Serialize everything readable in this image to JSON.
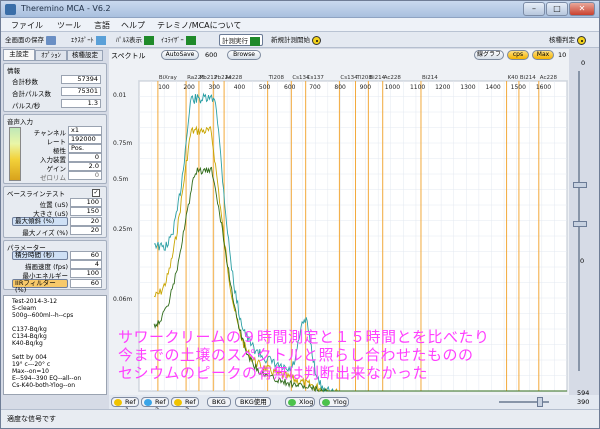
{
  "window": {
    "title": "Theremino MCA - V6.2"
  },
  "menu": [
    "ファイル",
    "ツール",
    "言語",
    "ヘルプ",
    "テレミノ/MCAについて"
  ],
  "toolbar": {
    "save_all": "全画面の保存",
    "export": "ｴｸｽﾎﾟｰﾄ",
    "pulse_display": "ﾊﾟﾙｽ表示",
    "equalizer": "ｲｺﾗｲｻﾞｰ",
    "measure": "計測実行",
    "new_measure": "新規計測開始",
    "nuclide": "核種判定"
  },
  "left": {
    "tabs": [
      "主設定",
      "ｵﾌﾟｼｮﾝ",
      "核種設定"
    ],
    "info": {
      "title": "情報",
      "rows": [
        {
          "label": "合計秒数",
          "value": "57394"
        },
        {
          "label": "合計パルス数",
          "value": "75301"
        },
        {
          "label": "パルス/秒",
          "value": "1.3"
        }
      ]
    },
    "audio": {
      "title": "音声入力",
      "rows": [
        {
          "label": "チャンネル",
          "value": "x1"
        },
        {
          "label": "レート",
          "value": "192000"
        },
        {
          "label": "極性",
          "value": "Pos."
        },
        {
          "label": "入力装置",
          "value": "0"
        },
        {
          "label": "ゲイン",
          "value": "2.0"
        },
        {
          "label": "ゼロリム",
          "value": "0"
        }
      ]
    },
    "baseline": {
      "title": "ベースラインテスト",
      "rows": [
        {
          "label": "位置 (uS)",
          "value": "100"
        },
        {
          "label": "大きさ (uS)",
          "value": "150"
        },
        {
          "label": "最大傾斜 (%)",
          "value": "20"
        },
        {
          "label": "最大ノイズ (%)",
          "value": "20"
        }
      ]
    },
    "params": {
      "title": "パラメーター",
      "rows": [
        {
          "label": "積分時間 (秒)",
          "value": "60"
        },
        {
          "label": "描画速度 (fps)",
          "value": "4"
        },
        {
          "label": "最小エネルギー",
          "value": "100"
        },
        {
          "label": "IIRフィルター (%)",
          "value": "60"
        }
      ]
    },
    "notes": [
      "Test-2014-3-12",
      "S-cleam",
      "500g--600ml--h--cps",
      "",
      "C137-Bq/kg",
      "C134-Bq/kg",
      "K40-Bq/kg",
      "",
      "Sett by 004",
      "19° c---20° c",
      "Max--on=10",
      "E--594--390  EQ--all--on",
      "Cs-K40-both-Ylog--on"
    ]
  },
  "plot": {
    "label": "スペクトル",
    "autosave": "AutoSave",
    "autosave_val": "600",
    "browse": "Browse",
    "lines_btn": "線グラフ",
    "cps_btn": "cps",
    "max_btn": "Max",
    "max_val": "10",
    "y_ticks": [
      "0.01",
      "0.75m",
      "0.5m",
      "0.25m",
      "0.06m"
    ],
    "x_ticks": [
      "100",
      "200",
      "300",
      "400",
      "500",
      "600",
      "700",
      "800",
      "900",
      "1000",
      "1100",
      "1200",
      "1300",
      "1400",
      "1500",
      "1600"
    ],
    "peaks": [
      "BiXray",
      "Ra226",
      "Pb212",
      "Pb214",
      "Ac228",
      "Tl208",
      "Cs134",
      "Cs137",
      "Cs134",
      "Tl208",
      "Bi214",
      "Ac228",
      "Bi214",
      "K40",
      "Bi214",
      "Ac228"
    ]
  },
  "right": {
    "top": "0",
    "mid": "0",
    "low1": "594",
    "low2": "390"
  },
  "bottom": {
    "ref1": "Ref 1",
    "ref2": "Ref 2",
    "ref3": "Ref 3",
    "bkg": "BKG",
    "bkg_use": "BKG使用",
    "xlog": "Xlog",
    "ylog": "Ylog"
  },
  "overlay": [
    "サワークリームの９時間測定と１５時間とを比べたり",
    "今までの土壌のスペクトルと照らし合わせたものの",
    "セシウムのピークの有無は判断出来なかった"
  ],
  "status": "適度な信号です",
  "chart_data": {
    "type": "line",
    "xlim": [
      0,
      1700
    ],
    "series": [
      {
        "name": "",
        "values": []
      }
    ]
  }
}
